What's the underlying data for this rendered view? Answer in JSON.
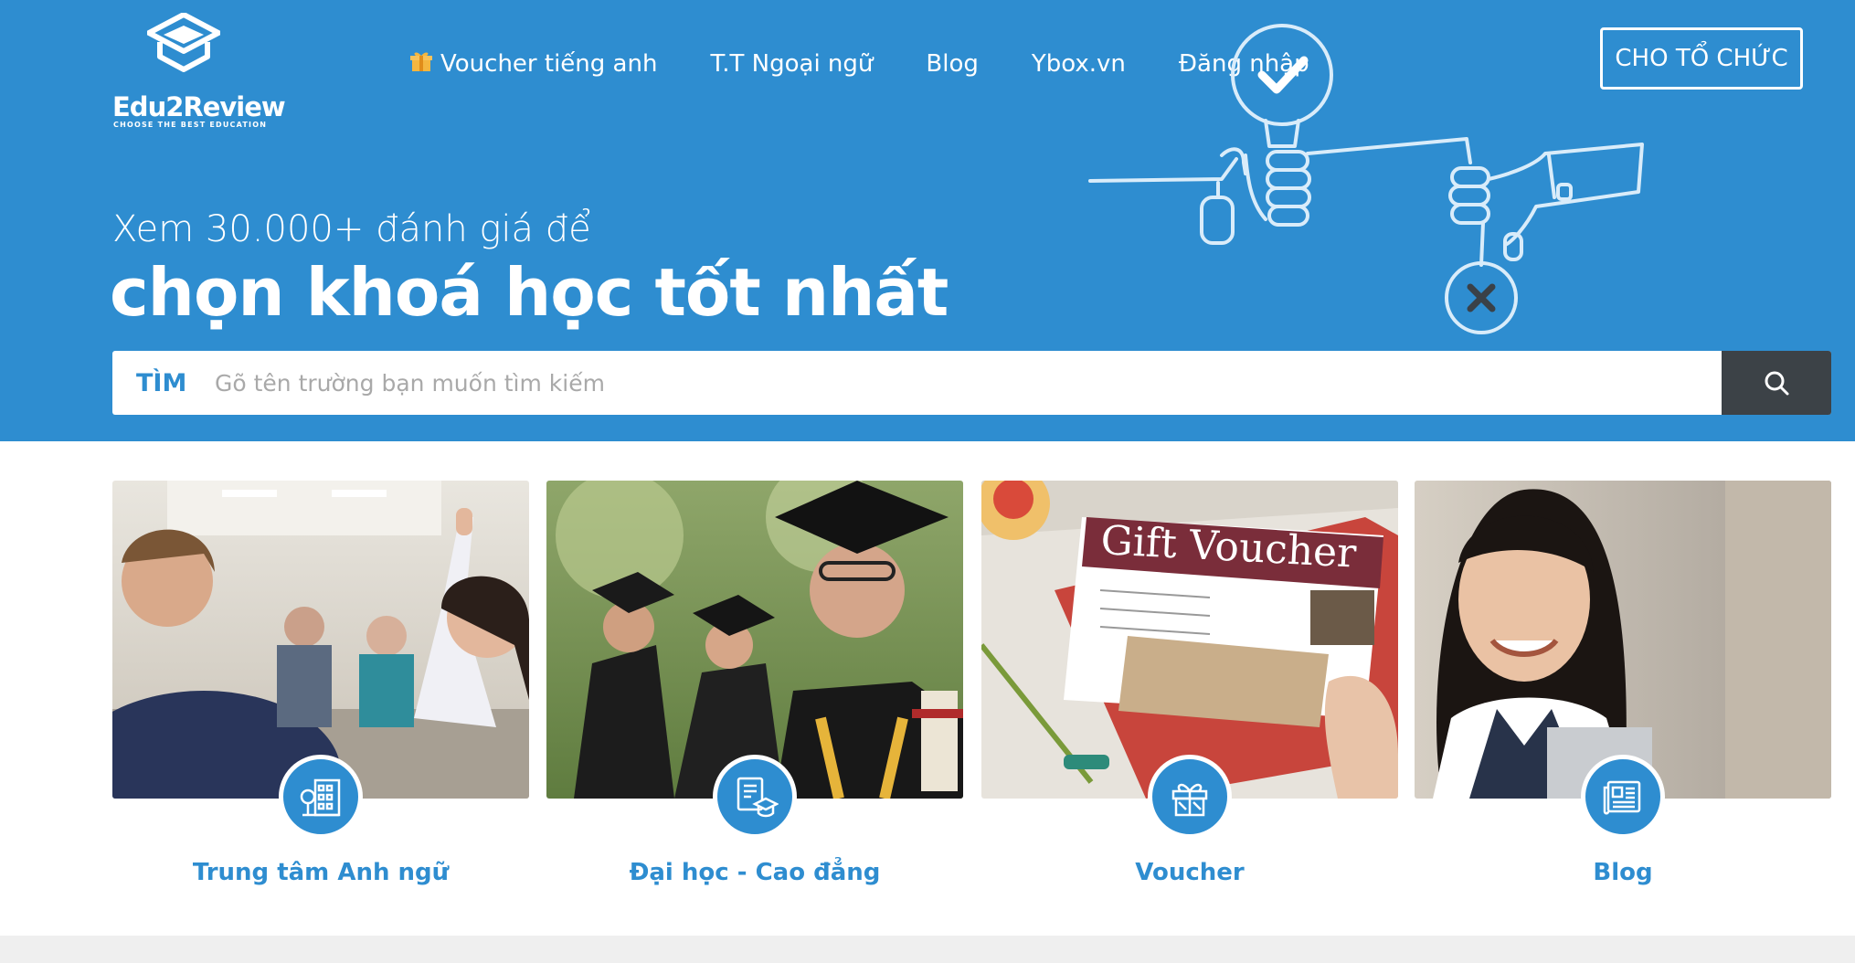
{
  "logo": {
    "name": "Edu2Review",
    "tagline": "CHOOSE THE BEST EDUCATION"
  },
  "nav": {
    "items": [
      {
        "label": "Voucher tiếng anh",
        "icon": "gift-icon"
      },
      {
        "label": "T.T Ngoại ngữ"
      },
      {
        "label": "Blog"
      },
      {
        "label": "Ybox.vn"
      },
      {
        "label": "Đăng nhập"
      }
    ],
    "org_button": "CHO TỔ CHỨC"
  },
  "hero": {
    "subheadline": "Xem 30.000+ đánh giá để",
    "headline": "chọn khoá học tốt nhất"
  },
  "search": {
    "label": "TÌM",
    "placeholder": "Gõ tên trường bạn muốn tìm kiếm",
    "button_icon": "search-icon"
  },
  "cards": [
    {
      "label": "Trung tâm Anh ngữ",
      "icon": "building-icon"
    },
    {
      "label": "Đại học - Cao đẳng",
      "icon": "graduation-document-icon"
    },
    {
      "label": "Voucher",
      "icon": "gift-icon"
    },
    {
      "label": "Blog",
      "icon": "newspaper-icon"
    }
  ],
  "colors": {
    "primary": "#2e8dd0",
    "search_button": "#3c4247",
    "white": "#ffffff"
  }
}
